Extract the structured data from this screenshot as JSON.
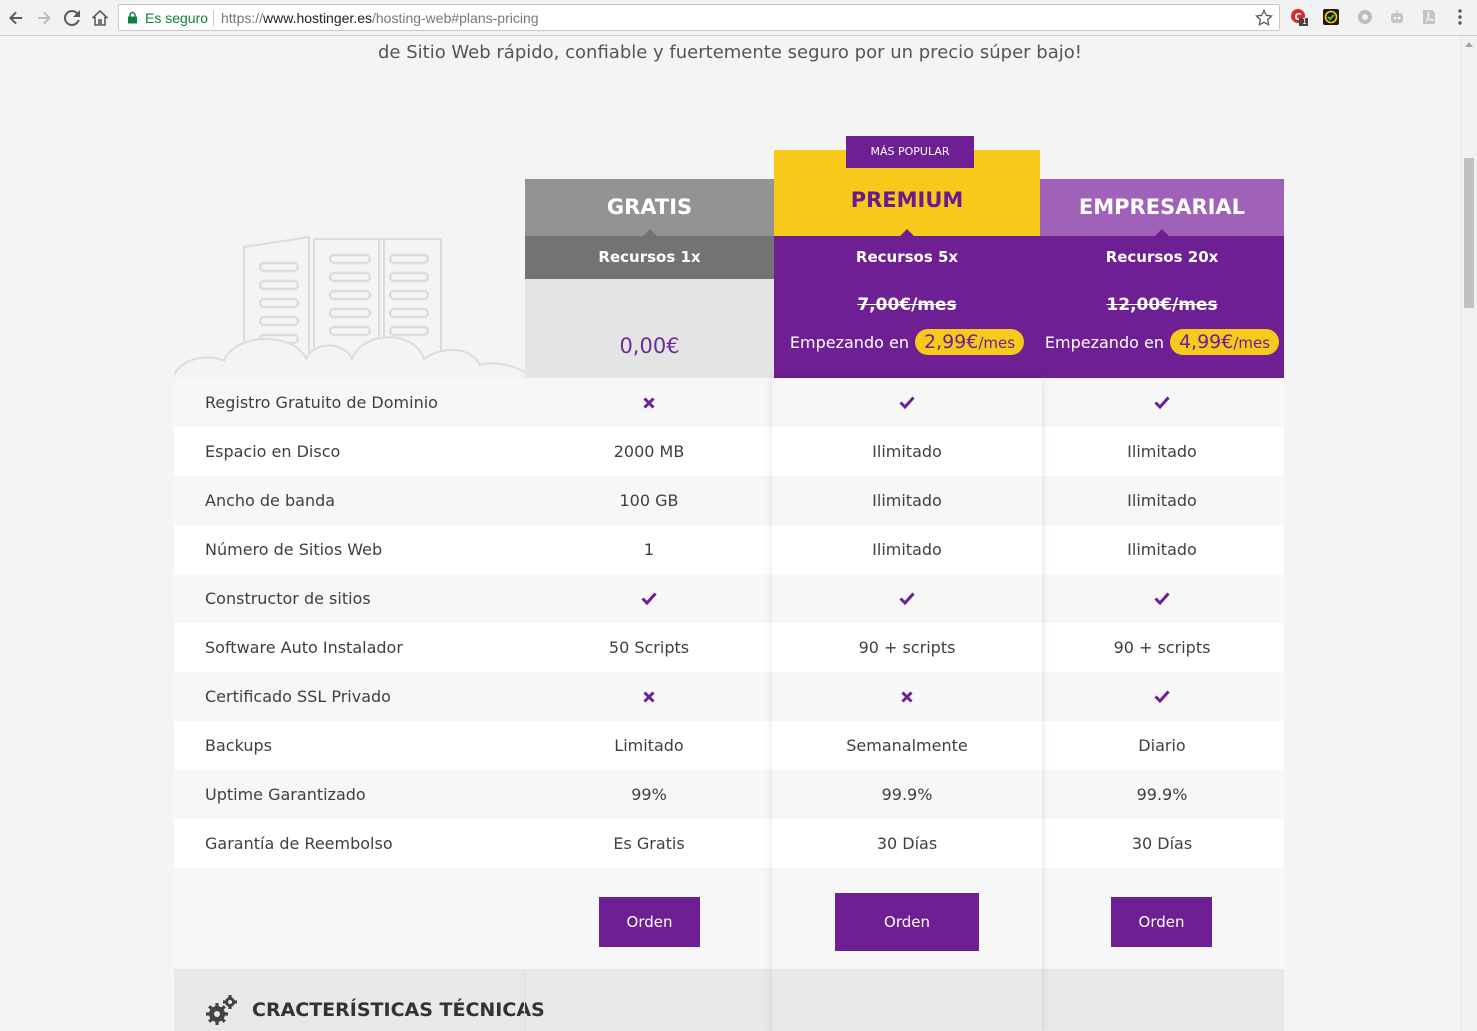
{
  "browser": {
    "secure_label": "Es seguro",
    "url_scheme": "https://",
    "url_host": "www.hostinger.es",
    "url_path": "/hosting-web#plans-pricing",
    "extension_badge": "1"
  },
  "intro": {
    "line2": "de Sitio Web rápido, confiable y fuertemente seguro por un precio súper bajo!"
  },
  "plans": {
    "popular_badge": "MÁS POPULAR",
    "gratis": {
      "name": "GRATIS",
      "resources": "Recursos 1x",
      "price": "0,00€"
    },
    "premium": {
      "name": "PREMIUM",
      "resources": "Recursos 5x",
      "old_price": "7,00€/mes",
      "start_label": "Empezando en",
      "price": "2,99€",
      "price_unit": "/mes"
    },
    "empresarial": {
      "name": "EMPRESARIAL",
      "resources": "Recursos 20x",
      "old_price": "12,00€/mes",
      "start_label": "Empezando en",
      "price": "4,99€",
      "price_unit": "/mes"
    }
  },
  "features": [
    {
      "label": "Registro Gratuito de Dominio",
      "gratis": "x",
      "premium": "check",
      "empresarial": "check"
    },
    {
      "label": "Espacio en Disco",
      "gratis": "2000 MB",
      "premium": "Ilimitado",
      "empresarial": "Ilimitado"
    },
    {
      "label": "Ancho de banda",
      "gratis": "100 GB",
      "premium": "Ilimitado",
      "empresarial": "Ilimitado"
    },
    {
      "label": "Número de Sitios Web",
      "gratis": "1",
      "premium": "Ilimitado",
      "empresarial": "Ilimitado"
    },
    {
      "label": "Constructor de sitios",
      "gratis": "check",
      "premium": "check",
      "empresarial": "check"
    },
    {
      "label": "Software Auto Instalador",
      "gratis": "50 Scripts",
      "premium": "90 + scripts",
      "empresarial": "90 + scripts"
    },
    {
      "label": "Certificado SSL Privado",
      "gratis": "x",
      "premium": "x",
      "empresarial": "check"
    },
    {
      "label": "Backups",
      "gratis": "Limitado",
      "premium": "Semanalmente",
      "empresarial": "Diario"
    },
    {
      "label": "Uptime Garantizado",
      "gratis": "99%",
      "premium": "99.9%",
      "empresarial": "99.9%"
    },
    {
      "label": "Garantía de Reembolso",
      "gratis": "Es Gratis",
      "premium": "30 Días",
      "empresarial": "30 Días"
    }
  ],
  "order_label": "Orden",
  "tech_section": {
    "title": "CRACTERÍSTICAS TÉCNICAS"
  },
  "colors": {
    "purple": "#6e1f93",
    "yellow": "#f6c91b",
    "gray_header": "#939393",
    "light_purple": "#a061b9"
  }
}
